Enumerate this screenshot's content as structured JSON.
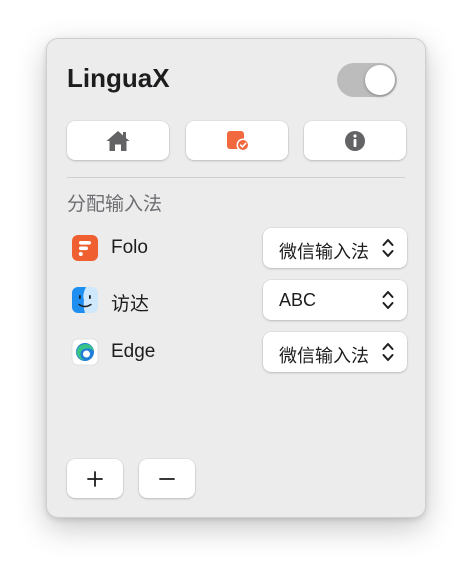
{
  "app": {
    "title": "LinguaX"
  },
  "toggle": {
    "state": "on"
  },
  "tabs": [
    {
      "icon": "home-icon"
    },
    {
      "icon": "app-check-icon"
    },
    {
      "icon": "info-icon"
    }
  ],
  "section": {
    "title": "分配输入法"
  },
  "rows": [
    {
      "app": "Folo",
      "input_method": "微信输入法",
      "icon": "folo-app-icon"
    },
    {
      "app": "访达",
      "input_method": "ABC",
      "icon": "finder-app-icon"
    },
    {
      "app": "Edge",
      "input_method": "微信输入法",
      "icon": "edge-app-icon"
    }
  ],
  "buttons": {
    "add": "+",
    "remove": "−"
  },
  "colors": {
    "accent": "#f2693f",
    "folo": "#ef5f2f",
    "toggle_track": "#bcbcbc"
  }
}
